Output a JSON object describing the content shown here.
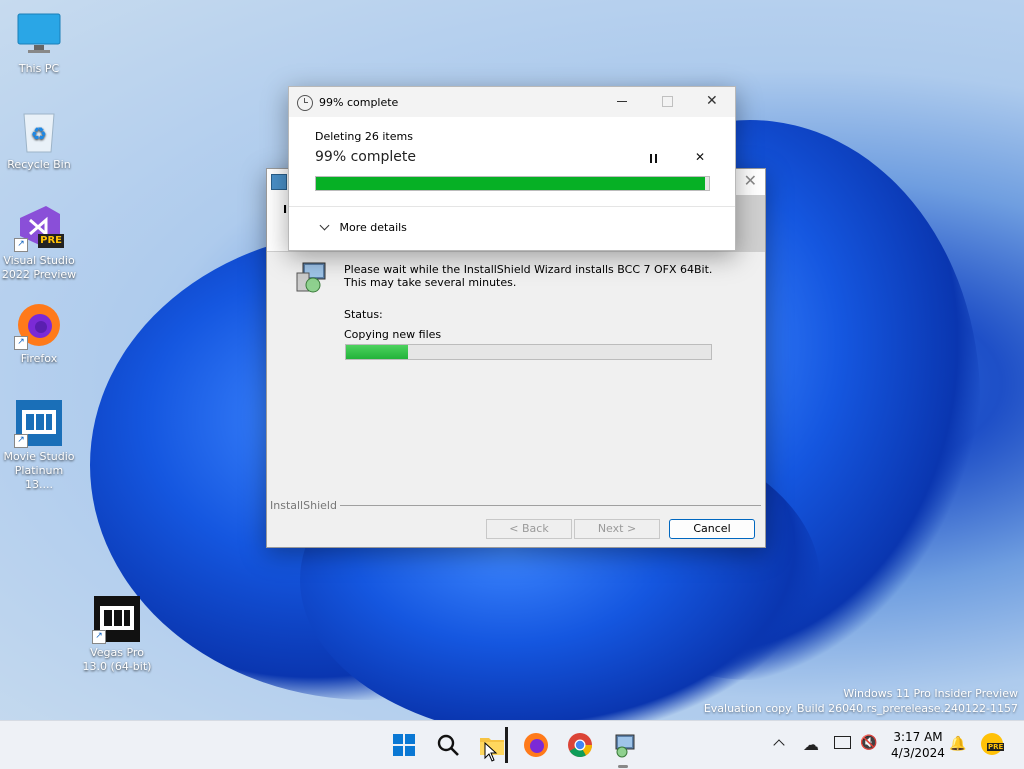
{
  "desktop": {
    "icons": [
      {
        "label": "This PC"
      },
      {
        "label": "Recycle Bin"
      },
      {
        "label": "Visual Studio 2022 Preview",
        "badge": "PRE"
      },
      {
        "label": "Firefox"
      },
      {
        "label": "Movie Studio Platinum 13...."
      },
      {
        "label": "Vegas Pro 13.0 (64-bit)"
      }
    ],
    "watermark": {
      "line1": "Windows 11 Pro Insider Preview",
      "line2": "Evaluation copy. Build 26040.rs_prerelease.240122-1157"
    }
  },
  "installer": {
    "body_text": "Please wait while the InstallShield Wizard installs BCC 7 OFX 64Bit. This may take several minutes.",
    "status_label": "Status:",
    "status_value": "Copying new files",
    "progress_fraction": 0.17,
    "brand": "InstallShield",
    "back_label": "< Back",
    "next_label": "Next >",
    "cancel_label": "Cancel",
    "header_letter": "I"
  },
  "delete_dialog": {
    "title": "99% complete",
    "subtitle": "Deleting 26 items",
    "headline": "99% complete",
    "progress_fraction": 0.99,
    "more_details": "More details"
  },
  "taskbar": {
    "time": "3:17 AM",
    "date": "4/3/2024",
    "pre_badge": "PRE"
  },
  "colors": {
    "progress_green": "#06b025",
    "accent": "#0067c0"
  }
}
